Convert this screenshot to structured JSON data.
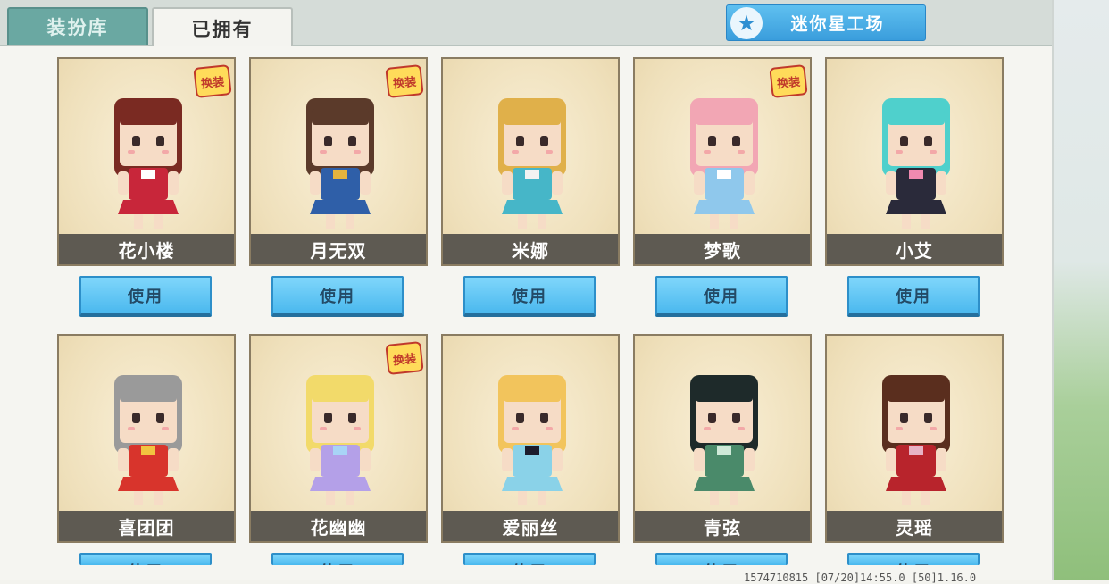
{
  "tabs": [
    {
      "label": "装扮库",
      "active": false
    },
    {
      "label": "已拥有",
      "active": true
    }
  ],
  "workshop_button": {
    "label": "迷你星工场",
    "icon": "star-icon"
  },
  "limited_badge_text": "换装",
  "use_label": "使用",
  "characters": [
    {
      "name": "花小楼",
      "limited": true,
      "hair": "#7a2a22",
      "outfit": "#c8263a",
      "accent": "#ffffff"
    },
    {
      "name": "月无双",
      "limited": true,
      "hair": "#5b3a2a",
      "outfit": "#2f5fa8",
      "accent": "#e5b43c"
    },
    {
      "name": "米娜",
      "limited": false,
      "hair": "#e0b04a",
      "outfit": "#46b6c8",
      "accent": "#f2f2f2"
    },
    {
      "name": "梦歌",
      "limited": true,
      "hair": "#f2a6b4",
      "outfit": "#8fc8ec",
      "accent": "#ffffff"
    },
    {
      "name": "小艾",
      "limited": false,
      "hair": "#4fd0cc",
      "outfit": "#2a2a3a",
      "accent": "#f08ab0"
    },
    {
      "name": "喜团团",
      "limited": false,
      "hair": "#9a9a9a",
      "outfit": "#d8342c",
      "accent": "#f2c440"
    },
    {
      "name": "花幽幽",
      "limited": true,
      "hair": "#f2da6a",
      "outfit": "#b4a0e8",
      "accent": "#a8d4f6"
    },
    {
      "name": "爱丽丝",
      "limited": false,
      "hair": "#f2c45c",
      "outfit": "#8ad2e8",
      "accent": "#1c1c2c"
    },
    {
      "name": "青弦",
      "limited": false,
      "hair": "#1e2a2a",
      "outfit": "#4a8a6a",
      "accent": "#cfe9d8"
    },
    {
      "name": "灵瑶",
      "limited": false,
      "hair": "#5a2e1e",
      "outfit": "#b8242c",
      "accent": "#e7b2c4"
    }
  ],
  "footer_text": "1574710815    [07/20]14:55.0  [50]1.16.0"
}
